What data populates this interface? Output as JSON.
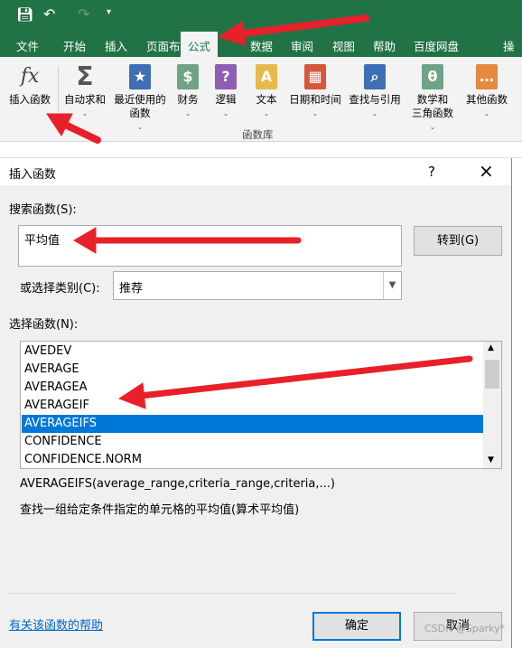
{
  "ribbon_tabs": [
    "文件",
    "开始",
    "插入",
    "页面布局",
    "公式",
    "数据",
    "审阅",
    "视图",
    "帮助",
    "百度网盘",
    "操作"
  ],
  "active_tab": "公式",
  "ribbon_buttons": [
    {
      "label": "插入函数",
      "icon": "fx-icon"
    },
    {
      "label": "自动求和",
      "icon": "sigma-icon"
    },
    {
      "label": "最近使用的\n函数",
      "icon": "star-book-icon",
      "color": "#3f6fb5"
    },
    {
      "label": "财务",
      "icon": "coins-book-icon",
      "color": "#6fa386"
    },
    {
      "label": "逻辑",
      "icon": "question-book-icon",
      "color": "#8e5db4"
    },
    {
      "label": "文本",
      "icon": "text-book-icon",
      "color": "#e7b94f"
    },
    {
      "label": "日期和时间",
      "icon": "calendar-book-icon",
      "color": "#d6573b"
    },
    {
      "label": "查找与引用",
      "icon": "search-book-icon",
      "color": "#3f6fb5"
    },
    {
      "label": "数学和\n三角函数",
      "icon": "theta-book-icon",
      "color": "#6fa386"
    },
    {
      "label": "其他函数",
      "icon": "more-book-icon",
      "color": "#e58a3d"
    }
  ],
  "ribbon_group": "函数库",
  "dialog": {
    "title": "插入函数",
    "help": "?",
    "close": "×",
    "search_label": "搜索函数(S):",
    "search_value": "平均值",
    "go_button": "转到(G)",
    "category_label": "或选择类别(C):",
    "category_value": "推荐",
    "list_label": "选择函数(N):",
    "functions": [
      "AVEDEV",
      "AVERAGE",
      "AVERAGEA",
      "AVERAGEIF",
      "AVERAGEIFS",
      "CONFIDENCE",
      "CONFIDENCE.NORM"
    ],
    "selected": "AVERAGEIFS",
    "signature": "AVERAGEIFS(average_range,criteria_range,criteria,...)",
    "description": "查找一组给定条件指定的单元格的平均值(算术平均值)",
    "help_link": "有关该函数的帮助",
    "ok": "确定",
    "cancel": "取消"
  },
  "watermark": "CSDN @Sparky*",
  "colors": {
    "excel_green": "#217346",
    "selection": "#0078d7",
    "annotation_arrow": "#e8202a"
  }
}
